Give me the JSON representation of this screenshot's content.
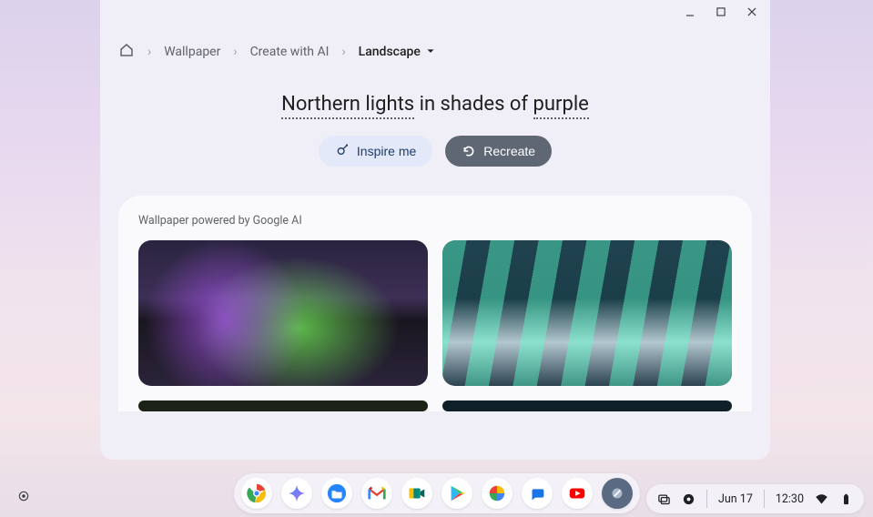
{
  "window": {
    "breadcrumb": {
      "home": "Home",
      "items": [
        "Wallpaper",
        "Create with AI"
      ],
      "active": "Landscape"
    },
    "prompt": {
      "part1": "Northern lights",
      "middle": " in shades of ",
      "part2": "purple"
    },
    "buttons": {
      "inspire": "Inspire me",
      "recreate": "Recreate"
    },
    "panel_caption": "Wallpaper powered by Google AI"
  },
  "shelf": {
    "apps": [
      "chrome",
      "gemini",
      "files",
      "gmail",
      "meet",
      "play",
      "photos",
      "messages",
      "youtube",
      "canvas"
    ]
  },
  "systray": {
    "date": "Jun 17",
    "time": "12:30"
  }
}
